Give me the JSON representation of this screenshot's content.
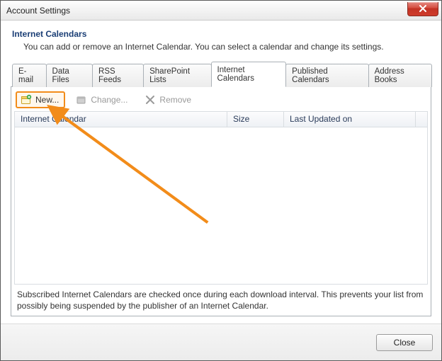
{
  "window": {
    "title": "Account Settings",
    "close_hint": "Close"
  },
  "header": {
    "heading": "Internet Calendars",
    "description": "You can add or remove an Internet Calendar. You can select a calendar and change its settings."
  },
  "tabs": [
    {
      "label": "E-mail",
      "active": false
    },
    {
      "label": "Data Files",
      "active": false
    },
    {
      "label": "RSS Feeds",
      "active": false
    },
    {
      "label": "SharePoint Lists",
      "active": false
    },
    {
      "label": "Internet Calendars",
      "active": true
    },
    {
      "label": "Published Calendars",
      "active": false
    },
    {
      "label": "Address Books",
      "active": false
    }
  ],
  "toolbar": {
    "new_label": "New...",
    "change_label": "Change...",
    "remove_label": "Remove"
  },
  "columns": {
    "name": "Internet Calendar",
    "size": "Size",
    "updated": "Last Updated on"
  },
  "rows": [],
  "footnote": "Subscribed Internet Calendars are checked once during each download interval. This prevents your list from possibly being suspended by the publisher of an Internet Calendar.",
  "buttons": {
    "close": "Close"
  },
  "annotation": {
    "target": "new-button",
    "color": "#f28c1a"
  }
}
